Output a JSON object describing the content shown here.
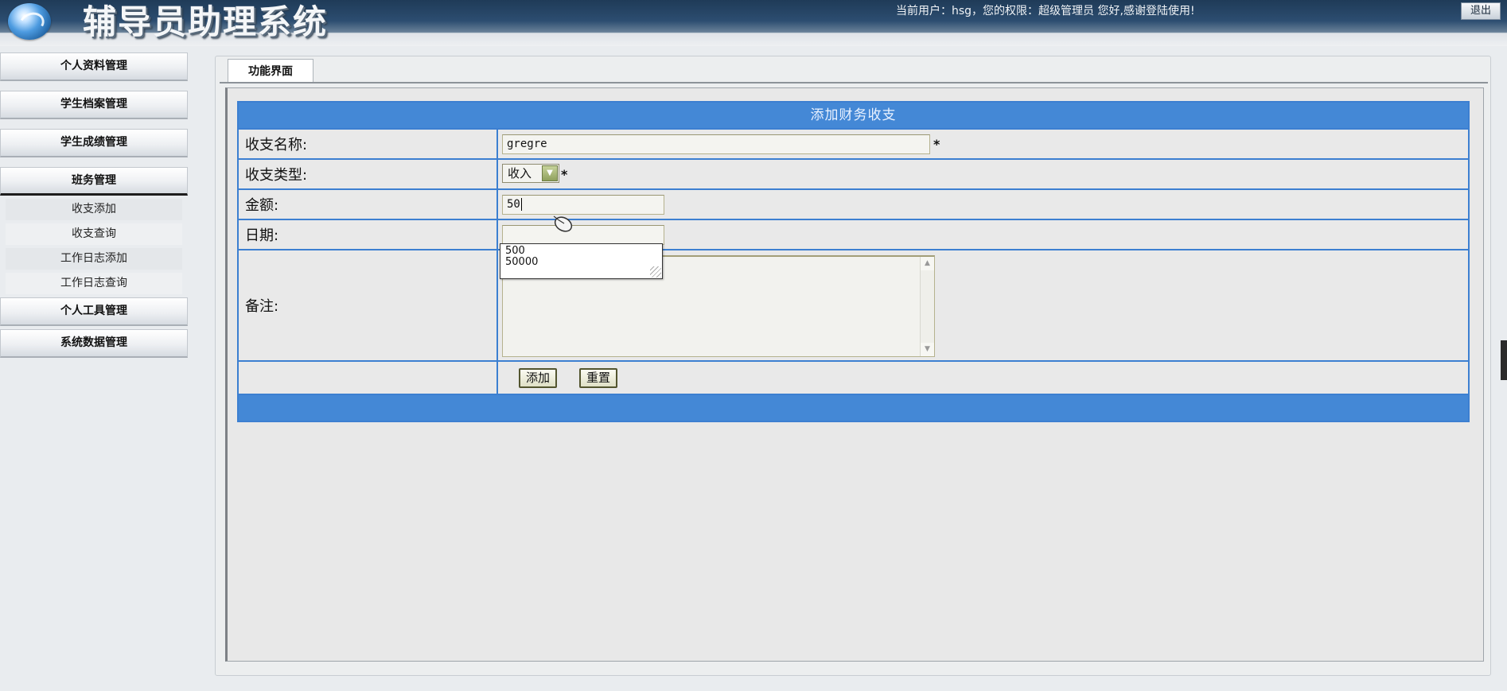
{
  "header": {
    "app_title": "辅导员助理系统",
    "user_info": "当前用户：hsg，您的权限：超级管理员 您好,感谢登陆使用!",
    "logout_label": "退出"
  },
  "sidebar": {
    "items": [
      {
        "label": "个人资料管理"
      },
      {
        "label": "学生档案管理"
      },
      {
        "label": "学生成绩管理"
      },
      {
        "label": "班务管理"
      },
      {
        "label": "个人工具管理"
      },
      {
        "label": "系统数据管理"
      }
    ],
    "submenu": [
      {
        "label": "收支添加"
      },
      {
        "label": "收支查询"
      },
      {
        "label": "工作日志添加"
      },
      {
        "label": "工作日志查询"
      }
    ]
  },
  "tabs": [
    {
      "label": "功能界面"
    }
  ],
  "form": {
    "title": "添加财务收支",
    "fields": {
      "name": {
        "label": "收支名称:",
        "value": "gregre",
        "required_mark": "*"
      },
      "type": {
        "label": "收支类型:",
        "value": "收入",
        "required_mark": "*"
      },
      "amount": {
        "label": "金额:",
        "value": "50"
      },
      "date": {
        "label": "日期:",
        "value": ""
      },
      "remark": {
        "label": "备注:",
        "value": ""
      }
    },
    "add_button": "添加",
    "reset_button": "重置"
  },
  "autocomplete": {
    "options": [
      "500",
      "50000"
    ]
  },
  "colors": {
    "header_dark": "#1f3b58",
    "table_blue": "#4488d6",
    "table_border": "#3c7fd1",
    "button_border": "#53552f"
  }
}
